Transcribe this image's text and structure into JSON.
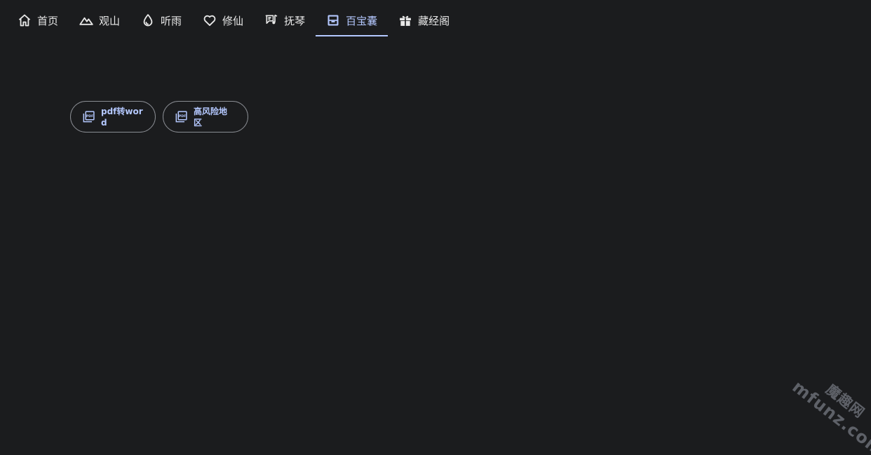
{
  "nav": {
    "items": [
      {
        "label": "首页",
        "icon": "home-icon"
      },
      {
        "label": "观山",
        "icon": "mountain-icon"
      },
      {
        "label": "听雨",
        "icon": "water-drop-icon"
      },
      {
        "label": "修仙",
        "icon": "heart-icon"
      },
      {
        "label": "抚琴",
        "icon": "music-note-icon"
      },
      {
        "label": "百宝囊",
        "icon": "inbox-icon",
        "active": true
      },
      {
        "label": "藏经阁",
        "icon": "gift-icon"
      }
    ]
  },
  "tools": [
    {
      "label": "pdf转word",
      "icon": "pdf-icon"
    },
    {
      "label": "高风险地区",
      "icon": "pdf-icon"
    }
  ],
  "watermark": {
    "cn": "魔趣网",
    "en": "mfunz.com"
  },
  "colors": {
    "background": "#1b1c1e",
    "accent": "#b4c8ff",
    "text": "#e8e8e8",
    "border": "#8a8d93"
  }
}
